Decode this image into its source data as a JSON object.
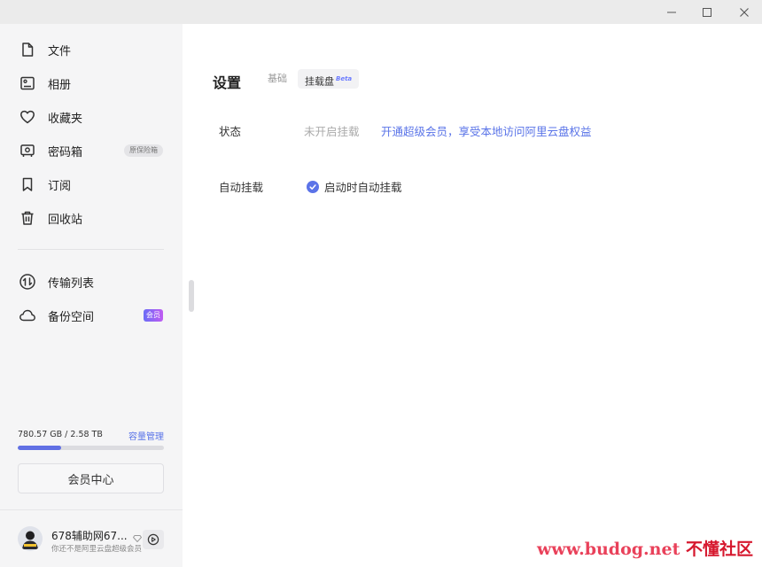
{
  "window_controls": {
    "minimize": "minimize",
    "maximize": "maximize",
    "close": "close"
  },
  "sidebar": {
    "items": [
      {
        "label": "文件",
        "icon": "file-icon"
      },
      {
        "label": "相册",
        "icon": "album-icon"
      },
      {
        "label": "收藏夹",
        "icon": "heart-icon"
      },
      {
        "label": "密码箱",
        "icon": "safe-icon",
        "tag": "原保险箱"
      },
      {
        "label": "订阅",
        "icon": "bookmark-icon"
      },
      {
        "label": "回收站",
        "icon": "trash-icon"
      }
    ],
    "items2": [
      {
        "label": "传输列表",
        "icon": "transfer-icon"
      },
      {
        "label": "备份空间",
        "icon": "cloud-icon",
        "tag": "会员"
      }
    ],
    "storage": {
      "text": "780.57 GB / 2.58 TB",
      "manage_label": "容量管理",
      "used_fraction": 0.295
    },
    "vip_button_label": "会员中心",
    "user": {
      "name": "678辅助网67...",
      "subtitle": "你还不是阿里云盘超级会员"
    }
  },
  "settings": {
    "title": "设置",
    "tabs": [
      {
        "label": "基础"
      },
      {
        "label": "挂载盘",
        "badge": "Beta"
      }
    ],
    "status_label": "状态",
    "status_value": "未开启挂载",
    "status_link": "开通超级会员，享受本地访问阿里云盘权益",
    "auto_mount_label": "自动挂载",
    "auto_mount_option": "启动时自动挂载",
    "auto_mount_checked": true
  },
  "watermark": {
    "left": "www.budog.net",
    "right": "不懂社区"
  },
  "colors": {
    "accent": "#5a74e8",
    "sidebar_bg": "#f5f5f6",
    "titlebar_bg": "#ebebeb",
    "progress": "#6170e4"
  }
}
